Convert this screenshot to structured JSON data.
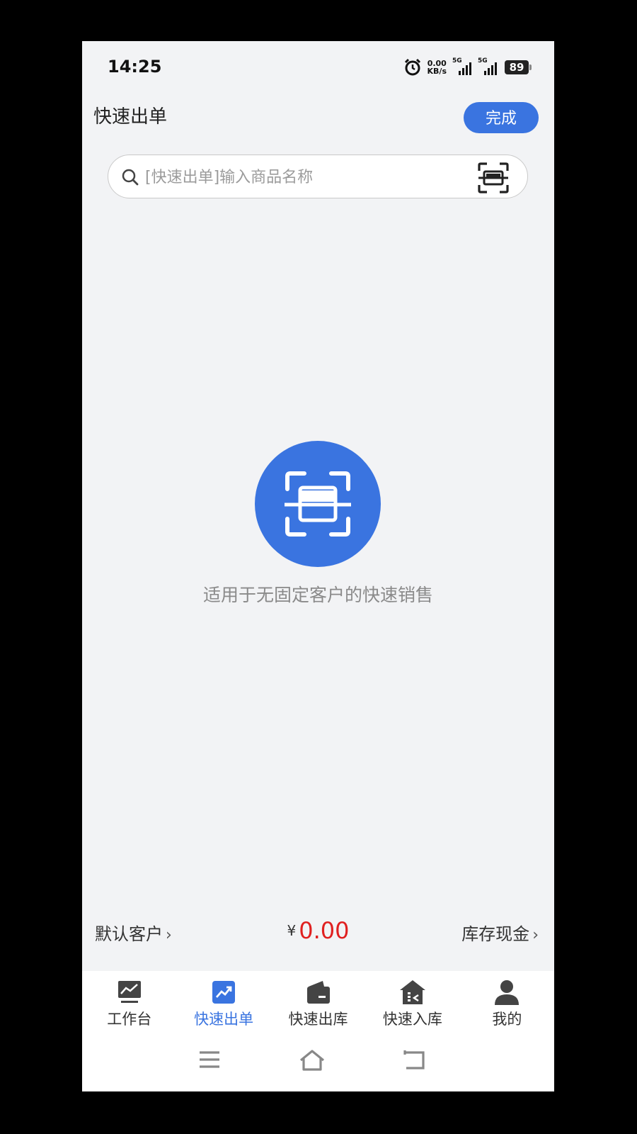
{
  "status_bar": {
    "time": "14:25",
    "net_speed_value": "0.00",
    "net_speed_unit": "KB/s",
    "signal1_label": "5G",
    "signal2_label": "5G",
    "battery": "89"
  },
  "header": {
    "title": "快速出单",
    "done_label": "完成"
  },
  "search": {
    "placeholder": "[快速出单]输入商品名称"
  },
  "main": {
    "empty_hint": "适用于无固定客户的快速销售"
  },
  "summary": {
    "customer_label": "默认客户",
    "currency_symbol": "¥",
    "total_amount": "0.00",
    "payment_label": "库存现金"
  },
  "nav": {
    "items": [
      {
        "label": "工作台",
        "icon": "chart-monitor-icon"
      },
      {
        "label": "快速出单",
        "icon": "trend-up-icon",
        "active": true
      },
      {
        "label": "快速出库",
        "icon": "wallet-out-icon"
      },
      {
        "label": "快速入库",
        "icon": "warehouse-in-icon"
      },
      {
        "label": "我的",
        "icon": "user-icon"
      }
    ]
  },
  "colors": {
    "accent": "#3a74e0",
    "amount": "#e02020",
    "background": "#f2f3f5"
  }
}
